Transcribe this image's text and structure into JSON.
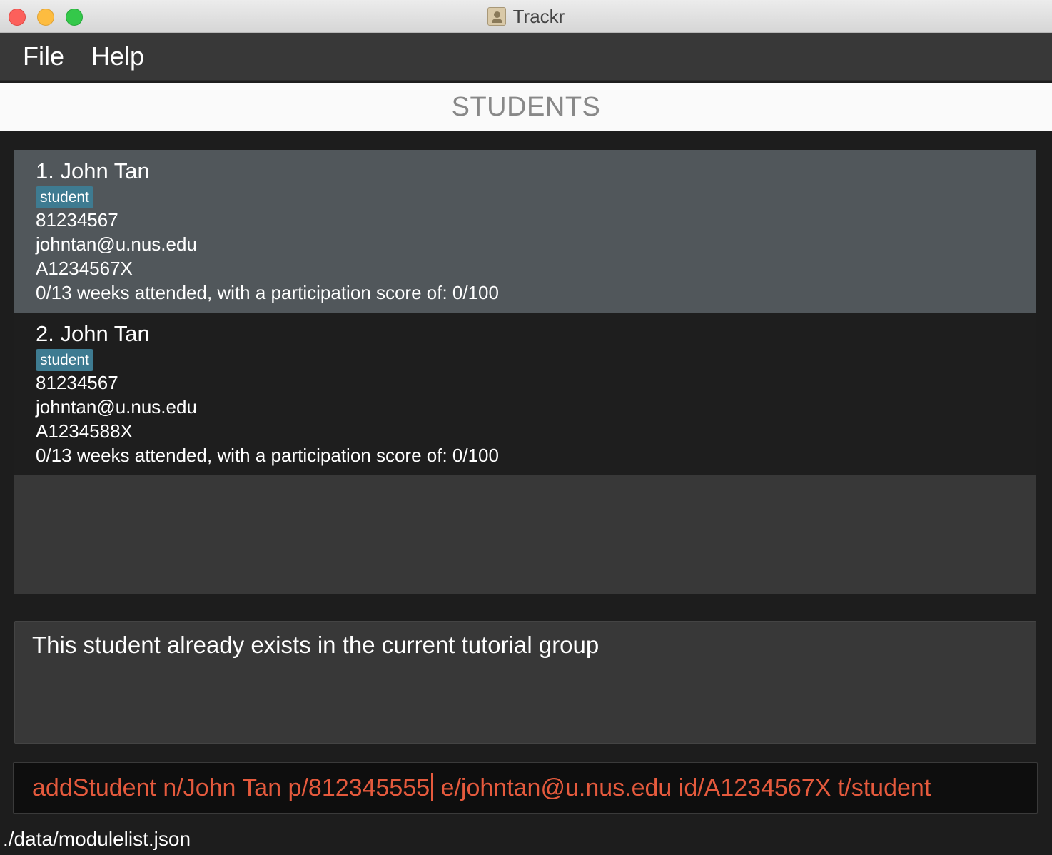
{
  "window": {
    "title": "Trackr"
  },
  "menu": {
    "file": "File",
    "help": "Help"
  },
  "header": {
    "title": "STUDENTS"
  },
  "students": [
    {
      "index_name": "1.  John Tan",
      "tag": "student",
      "phone": "81234567",
      "email": "johntan@u.nus.edu",
      "id": "A1234567X",
      "attendance": "0/13 weeks attended, with a participation score of: 0/100",
      "selected": true
    },
    {
      "index_name": "2.  John Tan",
      "tag": "student",
      "phone": "81234567",
      "email": "johntan@u.nus.edu",
      "id": "A1234588X",
      "attendance": "0/13 weeks attended, with a participation score of: 0/100",
      "selected": false
    }
  ],
  "result": {
    "message": "This student already exists in the current tutorial group"
  },
  "command": {
    "before_caret": "addStudent n/John Tan p/812345555",
    "after_caret": " e/johntan@u.nus.edu id/A1234567X t/student"
  },
  "status": {
    "path": "./data/modulelist.json"
  },
  "colors": {
    "accent_text": "#e55a3d",
    "tag_bg": "#3e7b91",
    "selected_card": "#51575b"
  }
}
